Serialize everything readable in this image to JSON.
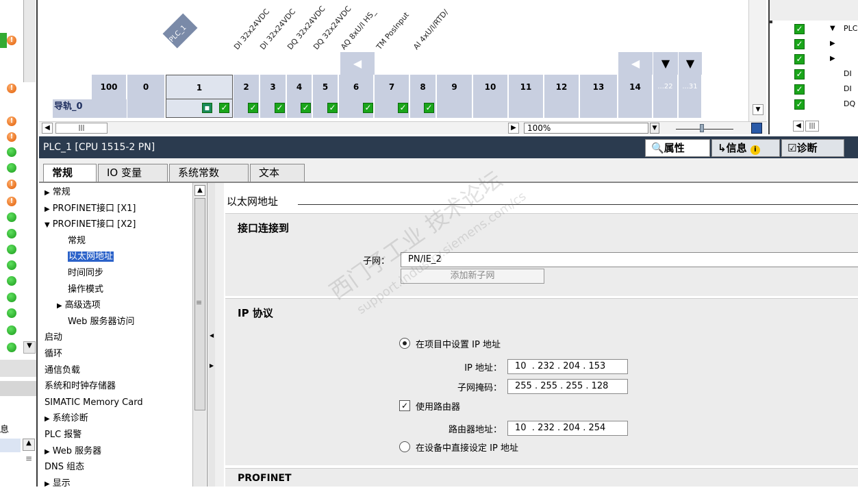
{
  "device_view": {
    "plc_label": "PLC_1",
    "rail_label": "导轨_0",
    "slots": [
      "100",
      "0",
      "1",
      "2",
      "3",
      "4",
      "5",
      "6",
      "7",
      "8",
      "9",
      "10",
      "11",
      "12",
      "13",
      "14",
      "...22",
      "...31"
    ],
    "modules": [
      "DI 32x24VDC",
      "DI 32x24VDC",
      "DQ 32x24VDC",
      "DQ 32x24VDC",
      "AQ 8xU/I HS_",
      "TM PosInput",
      "AI 4xU/I/RTD/"
    ],
    "zoom": "100%"
  },
  "right_panel": {
    "rows": [
      "PLC",
      "",
      "",
      "DI",
      "DI",
      "DQ"
    ]
  },
  "inspector": {
    "title": "PLC_1 [CPU 1515-2 PN]",
    "tabs": {
      "properties": "属性",
      "info": "信息",
      "diagnostics": "诊断"
    },
    "subtabs": [
      "常规",
      "IO 变量",
      "系统常数",
      "文本"
    ],
    "nav": [
      {
        "label": "常规",
        "indent": 0,
        "arrow": "▶"
      },
      {
        "label": "PROFINET接口 [X1]",
        "indent": 0,
        "arrow": "▶"
      },
      {
        "label": "PROFINET接口 [X2]",
        "indent": 0,
        "arrow": "▼"
      },
      {
        "label": "常规",
        "indent": 1,
        "arrow": ""
      },
      {
        "label": "以太网地址",
        "indent": 1,
        "arrow": "",
        "selected": true
      },
      {
        "label": "时间同步",
        "indent": 1,
        "arrow": ""
      },
      {
        "label": "操作模式",
        "indent": 1,
        "arrow": ""
      },
      {
        "label": "高级选项",
        "indent": 1,
        "arrow": "▶"
      },
      {
        "label": "Web 服务器访问",
        "indent": 1,
        "arrow": ""
      },
      {
        "label": "启动",
        "indent": 0,
        "arrow": ""
      },
      {
        "label": "循环",
        "indent": 0,
        "arrow": ""
      },
      {
        "label": "通信负载",
        "indent": 0,
        "arrow": ""
      },
      {
        "label": "系统和时钟存储器",
        "indent": 0,
        "arrow": ""
      },
      {
        "label": "SIMATIC Memory Card",
        "indent": 0,
        "arrow": ""
      },
      {
        "label": "系统诊断",
        "indent": 0,
        "arrow": "▶"
      },
      {
        "label": "PLC 报警",
        "indent": 0,
        "arrow": ""
      },
      {
        "label": "Web 服务器",
        "indent": 0,
        "arrow": "▶"
      },
      {
        "label": "DNS 组态",
        "indent": 0,
        "arrow": ""
      },
      {
        "label": "显示",
        "indent": 0,
        "arrow": "▶"
      }
    ],
    "content": {
      "heading": "以太网地址",
      "interface_section": "接口连接到",
      "subnet_label": "子网：",
      "subnet_value": "PN/IE_2",
      "add_subnet_button": "添加新子网",
      "ip_section": "IP 协议",
      "radio_project": "在项目中设置 IP 地址",
      "ip_label": "IP 地址：",
      "ip_value": "10  . 232 . 204 . 153",
      "mask_label": "子网掩码：",
      "mask_value": "255 . 255 . 255 . 128",
      "router_check": "使用路由器",
      "router_label": "路由器地址：",
      "router_value": "10  . 232 . 204 . 254",
      "radio_device": "在设备中直接设定 IP 地址",
      "profinet_section": "PROFINET"
    }
  },
  "watermark": {
    "line1": "西门子工业 技术论坛",
    "line2": "support.industry.siemens.com/cs"
  }
}
